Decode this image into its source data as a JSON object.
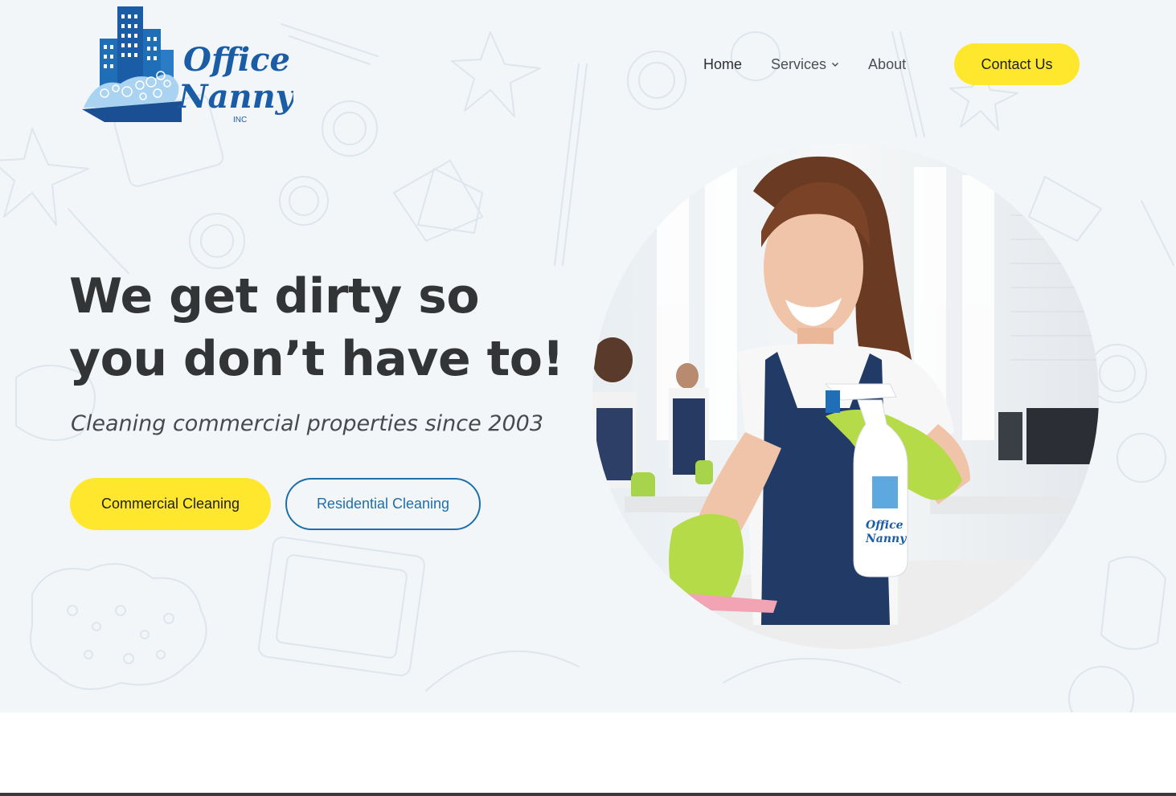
{
  "brand": {
    "name_line1": "Office",
    "name_line2": "Nanny",
    "suffix": "INC"
  },
  "nav": {
    "items": [
      {
        "label": "Home"
      },
      {
        "label": "Services",
        "has_dropdown": true
      },
      {
        "label": "About"
      }
    ],
    "contact_label": "Contact Us"
  },
  "hero": {
    "headline": "We get dirty so you don’t have to!",
    "tagline": "Cleaning commercial properties since 2003",
    "primary_button": "Commercial Cleaning",
    "secondary_button": "Residential Cleaning",
    "bottle_brand_line1": "Office",
    "bottle_brand_line2": "Nanny"
  },
  "colors": {
    "accent_yellow": "#ffe72e",
    "brand_blue": "#1e6fa8",
    "hero_bg": "#f3f6f9",
    "text_dark": "#333436"
  }
}
